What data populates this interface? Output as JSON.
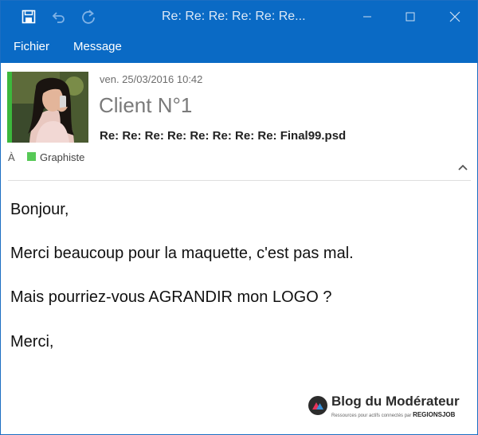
{
  "titlebar": {
    "title": "Re: Re: Re: Re: Re: Re...",
    "save_icon": "save-icon",
    "undo_icon": "undo-icon",
    "redo_icon": "redo-icon"
  },
  "menu": {
    "items": [
      {
        "label": "Fichier"
      },
      {
        "label": "Message"
      }
    ]
  },
  "email": {
    "date": "ven. 25/03/2016  10:42",
    "sender": "Client N°1",
    "subject": "Re: Re: Re: Re: Re: Re: Re: Re: Final99.psd",
    "to_label": "À",
    "category": {
      "label": "Graphiste",
      "color": "#57c957"
    }
  },
  "body": {
    "lines": [
      "Bonjour,",
      "Merci beaucoup pour la maquette, c'est pas mal.",
      "Mais pourriez-vous AGRANDIR mon LOGO ?",
      "Merci,"
    ]
  },
  "watermark": {
    "name": "Blog du Modérateur",
    "tagline": "Ressources pour actifs connectés par",
    "tagline_brand": "REGIONSJOB"
  },
  "colors": {
    "titlebar": "#0a6ac5",
    "accent": "#3cb83c"
  }
}
